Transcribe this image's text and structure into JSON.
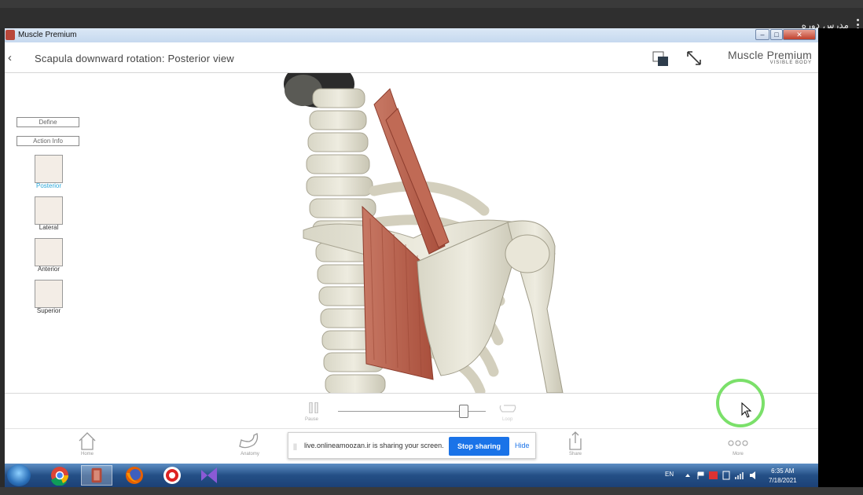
{
  "host": {
    "title": "مدرس دوره"
  },
  "window": {
    "title": "Muscle Premium",
    "buttons": {
      "minimize": "–",
      "maximize": "□",
      "close": "✕"
    }
  },
  "header": {
    "back": "‹",
    "title": "Scapula downward rotation: Posterior view",
    "brand_main": "Muscle Premium",
    "brand_sub": "VISIBLE BODY"
  },
  "sidebar": {
    "buttons": [
      {
        "label": "Define"
      },
      {
        "label": "Action Info"
      }
    ],
    "views": [
      {
        "label": "Posterior",
        "active": true
      },
      {
        "label": "Lateral",
        "active": false
      },
      {
        "label": "Anterior",
        "active": false
      },
      {
        "label": "Superior",
        "active": false
      }
    ]
  },
  "playback": {
    "pause_label": "Pause",
    "loop_label": "Loop",
    "progress": 0.85
  },
  "bottom_nav": {
    "home": "Home",
    "anatomy": "Anatomy",
    "share": "Share",
    "more": "More"
  },
  "screen_share": {
    "text": "live.onlineamoozan.ir is sharing your screen.",
    "stop": "Stop sharing",
    "hide": "Hide"
  },
  "taskbar": {
    "apps": [
      "start-orb",
      "chrome",
      "muscle-premium",
      "firefox",
      "recorder",
      "visual-studio"
    ],
    "lang": "EN",
    "time": "6:35 AM",
    "date": "7/18/2021"
  },
  "colors": {
    "accent": "#1a73e8",
    "active_view": "#2aa7d8",
    "cursor_ring": "#7be06a",
    "muscle": "#b8604c"
  }
}
